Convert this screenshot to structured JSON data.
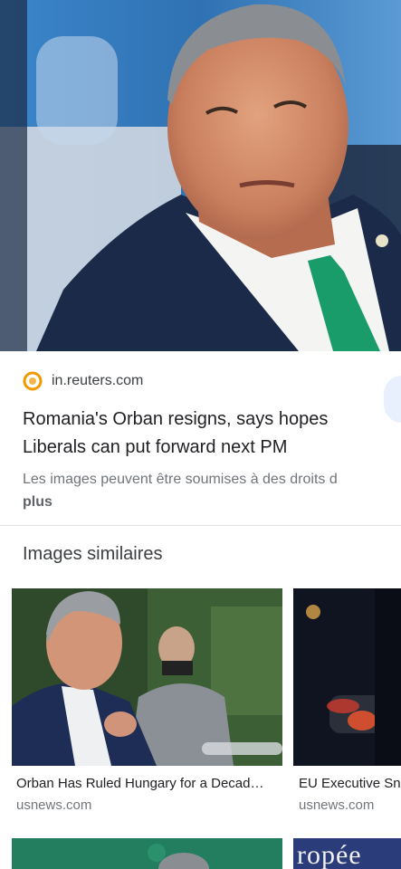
{
  "result": {
    "source_domain": "in.reuters.com",
    "title": "Romania's Orban resigns, says hopes Liberals can put forward next PM",
    "rights_notice": "Les images peuvent être soumises à des droits d",
    "more_label": "plus"
  },
  "similar": {
    "heading": "Images similaires",
    "items": [
      {
        "caption": "Orban Has Ruled Hungary for a Decad…",
        "site": "usnews.com"
      },
      {
        "caption": "EU Executive Sn",
        "site": "usnews.com"
      }
    ],
    "partial_thumb_text": "ropée"
  },
  "colors": {
    "accent_logo": "#f29900",
    "tie": "#1a9b6a",
    "suit": "#1c2a4a"
  }
}
